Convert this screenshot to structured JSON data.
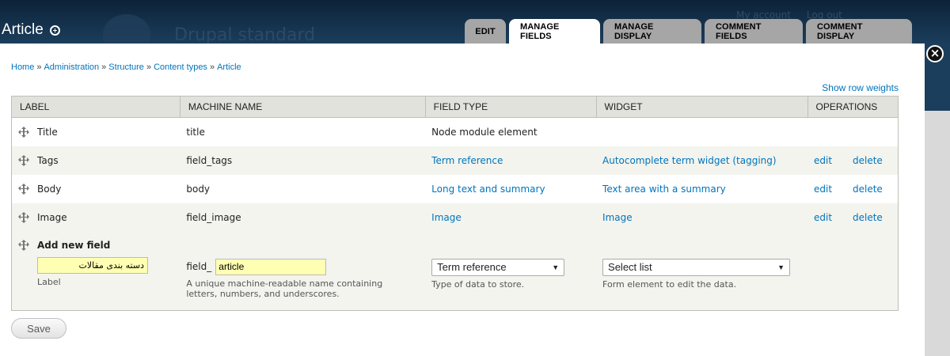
{
  "background": {
    "site_name": "Drupal standard",
    "user_links": [
      "My account",
      "Log out"
    ]
  },
  "overlay": {
    "title": "Article",
    "tabs": [
      {
        "label": "EDIT",
        "active": false
      },
      {
        "label": "MANAGE FIELDS",
        "active": true
      },
      {
        "label": "MANAGE DISPLAY",
        "active": false
      },
      {
        "label": "COMMENT FIELDS",
        "active": false
      },
      {
        "label": "COMMENT DISPLAY",
        "active": false
      }
    ],
    "close_label": "×"
  },
  "breadcrumb": [
    "Home",
    "Administration",
    "Structure",
    "Content types",
    "Article"
  ],
  "breadcrumb_separator": "»",
  "row_weights_label": "Show row weights",
  "table": {
    "headers": [
      "LABEL",
      "MACHINE NAME",
      "FIELD TYPE",
      "WIDGET",
      "OPERATIONS"
    ],
    "rows": [
      {
        "label": "Title",
        "machine": "title",
        "type": "Node module element",
        "widget": "",
        "edit": "",
        "delete": ""
      },
      {
        "label": "Tags",
        "machine": "field_tags",
        "type": "Term reference",
        "widget": "Autocomplete term widget (tagging)",
        "edit": "edit",
        "delete": "delete"
      },
      {
        "label": "Body",
        "machine": "body",
        "type": "Long text and summary",
        "widget": "Text area with a summary",
        "edit": "edit",
        "delete": "delete"
      },
      {
        "label": "Image",
        "machine": "field_image",
        "type": "Image",
        "widget": "Image",
        "edit": "edit",
        "delete": "delete"
      }
    ]
  },
  "new_field": {
    "title": "Add new field",
    "label_value": "دسته بندی مقالات",
    "label_desc": "Label",
    "machine_prefix": "field_",
    "machine_value": "article",
    "machine_desc": "A unique machine-readable name containing letters, numbers, and underscores.",
    "type_value": "Term reference",
    "type_desc": "Type of data to store.",
    "widget_value": "Select list",
    "widget_desc": "Form element to edit the data."
  },
  "save_label": "Save",
  "colors": {
    "link": "#0074bd",
    "highlight_input": "#ffffb3",
    "header_bg": "#e1e2dc"
  }
}
